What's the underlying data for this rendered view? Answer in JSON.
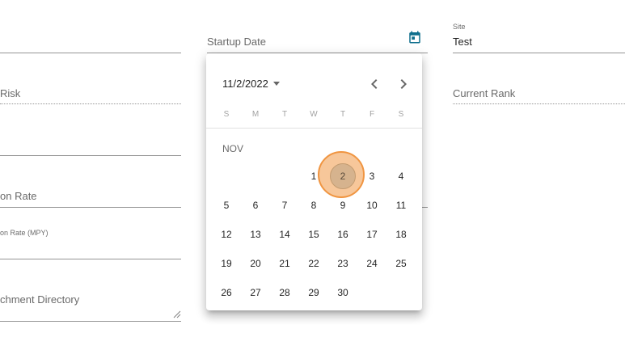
{
  "form": {
    "risk_label": "Risk",
    "rate_label": "on Rate",
    "mpy_label": "on Rate (MPY)",
    "attachment_label": "chment Directory",
    "startup_date_label": "Startup Date",
    "site_label": "Site",
    "site_value": "Test",
    "current_rank_label": "Current Rank",
    "calendar_icon": "calendar-icon",
    "calendar_icon_color": "#0d6e8c"
  },
  "datepicker": {
    "current_label": "11/2/2022",
    "prev_icon": "chevron-left-icon",
    "next_icon": "chevron-right-icon",
    "weekdays": [
      "S",
      "M",
      "T",
      "W",
      "T",
      "F",
      "S"
    ],
    "month_label": "NOV",
    "first_weekday": 3,
    "days": [
      "1",
      "2",
      "3",
      "4",
      "5",
      "6",
      "7",
      "8",
      "9",
      "10",
      "11",
      "12",
      "13",
      "14",
      "15",
      "16",
      "17",
      "18",
      "19",
      "20",
      "21",
      "22",
      "23",
      "24",
      "25",
      "26",
      "27",
      "28",
      "29",
      "30"
    ],
    "highlighted_day": "2",
    "highlight_color": "#f09541"
  }
}
